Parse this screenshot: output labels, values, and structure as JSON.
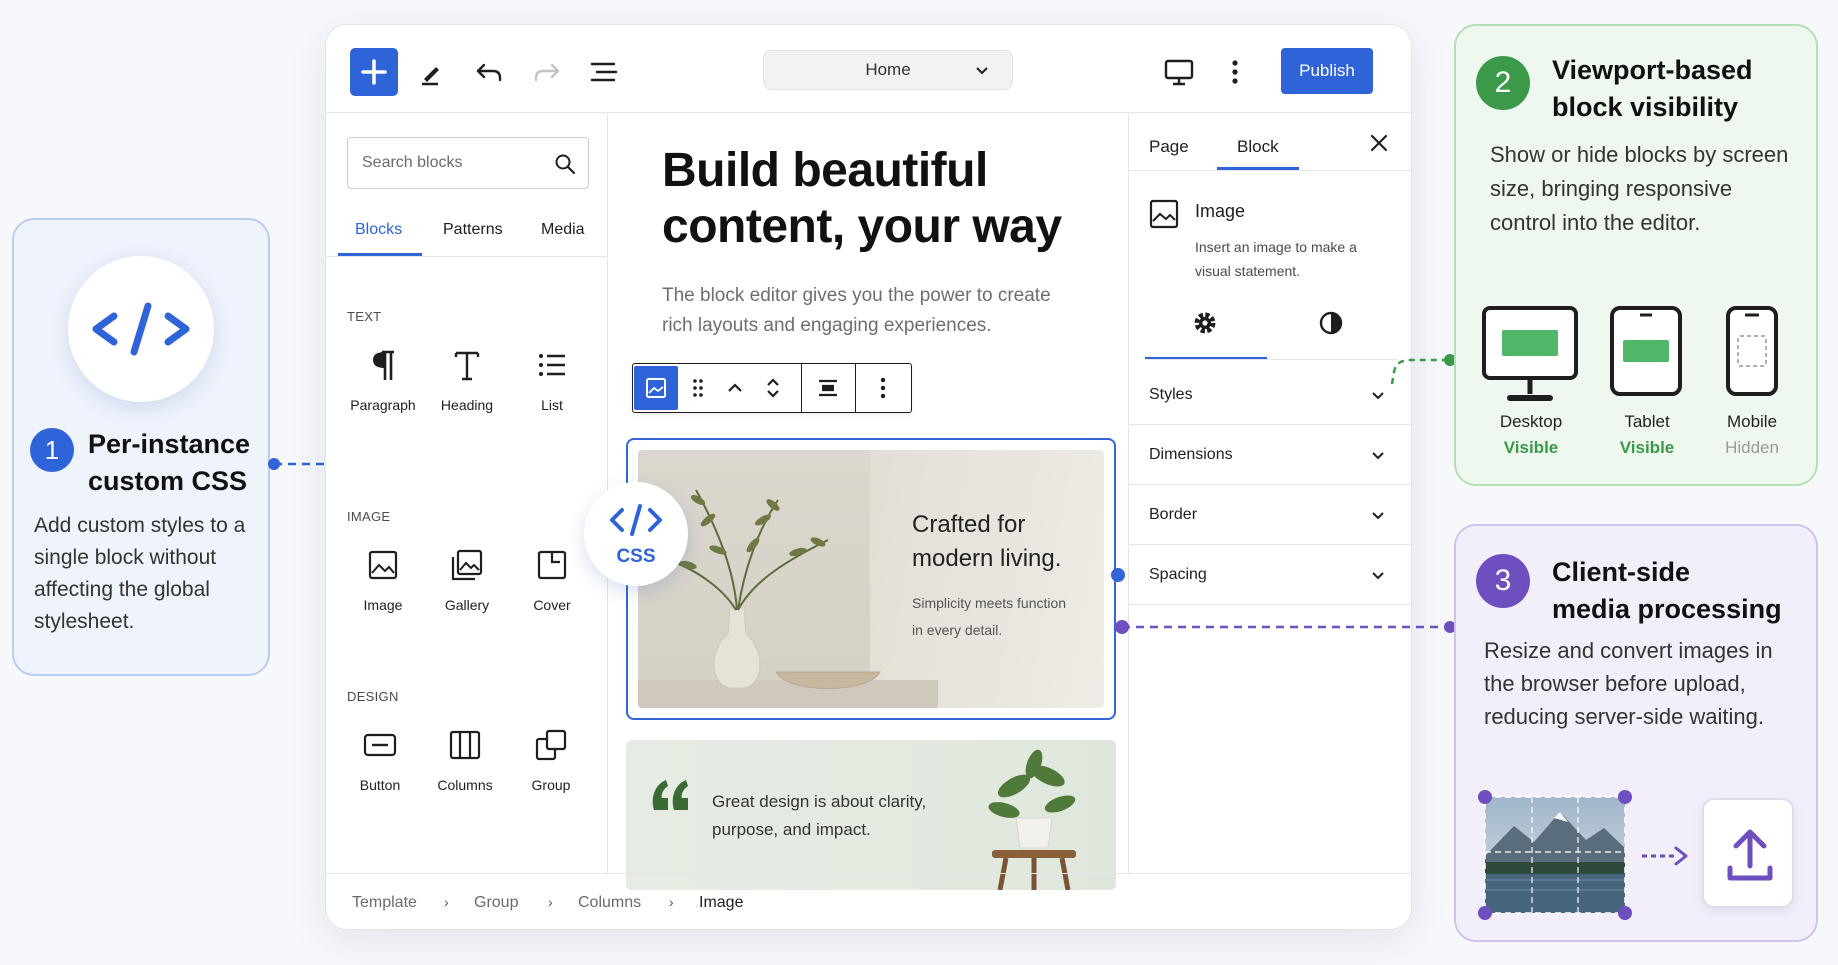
{
  "topbar": {
    "document_title": "Home",
    "publish_label": "Publish"
  },
  "inserter": {
    "search_placeholder": "Search blocks",
    "tabs": [
      "Blocks",
      "Patterns",
      "Media"
    ],
    "categories": {
      "text": {
        "label": "TEXT",
        "blocks": [
          "Paragraph",
          "Heading",
          "List"
        ]
      },
      "image": {
        "label": "IMAGE",
        "blocks": [
          "Image",
          "Gallery",
          "Cover"
        ]
      },
      "design": {
        "label": "DESIGN",
        "blocks": [
          "Button",
          "Columns",
          "Group"
        ]
      }
    }
  },
  "canvas": {
    "hero_title": "Build beautiful content, your way",
    "hero_subtitle": "The block editor gives you the power to create rich layouts and engaging experiences.",
    "image_block": {
      "title_line1": "Crafted for",
      "title_line2": "modern living.",
      "subtitle_line1": "Simplicity meets function",
      "subtitle_line2": "in every detail."
    },
    "quote_block": {
      "line1": "Great design is about clarity,",
      "line2": "purpose, and impact."
    },
    "css_badge": "CSS"
  },
  "sidebar": {
    "tabs": [
      "Page",
      "Block"
    ],
    "block_card": {
      "title": "Image",
      "description": "Insert an image to make a visual statement."
    },
    "panels": [
      "Styles",
      "Dimensions",
      "Border",
      "Spacing"
    ]
  },
  "breadcrumb": [
    "Template",
    "Group",
    "Columns",
    "Image"
  ],
  "callouts": {
    "css": {
      "number": "1",
      "title_line1": "Per-instance",
      "title_line2": "custom CSS",
      "body": "Add custom styles to a single block without affecting the global stylesheet."
    },
    "viewport": {
      "number": "2",
      "title_line1": "Viewport-based",
      "title_line2": "block visibility",
      "body": "Show or hide blocks by screen size, bringing responsive control into the editor.",
      "devices": [
        {
          "name": "Desktop",
          "state": "Visible"
        },
        {
          "name": "Tablet",
          "state": "Visible"
        },
        {
          "name": "Mobile",
          "state": "Hidden"
        }
      ]
    },
    "media": {
      "number": "3",
      "title_line1": "Client-side",
      "title_line2": "media processing",
      "body": "Resize and convert images in the browser before upload, reducing server-side waiting."
    }
  },
  "colors": {
    "accent": "#2f63d8",
    "green": "#3a9a49",
    "purple": "#6f4fc0"
  }
}
